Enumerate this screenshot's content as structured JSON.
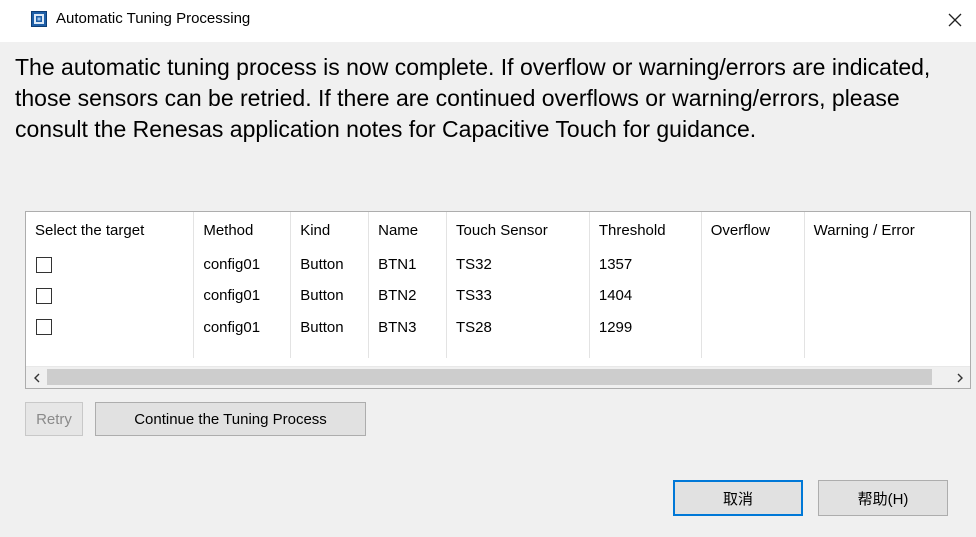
{
  "window": {
    "title": "Automatic Tuning Processing",
    "app_icon": "app-icon",
    "close_icon": "close-icon"
  },
  "message": "The automatic tuning process is now complete. If overflow or warning/errors are indicated, those sensors can be retried. If there are continued overflows or warning/errors, please consult the Renesas application notes for Capacitive Touch for guidance.",
  "table": {
    "columns": [
      "Select the target",
      "Method",
      "Kind",
      "Name",
      "Touch Sensor",
      "Threshold",
      "Overflow",
      "Warning / Error"
    ],
    "rows": [
      {
        "checked": false,
        "method": "config01",
        "kind": "Button",
        "name": "BTN1",
        "touch_sensor": "TS32",
        "threshold": "1357",
        "overflow": "",
        "warning_error": ""
      },
      {
        "checked": false,
        "method": "config01",
        "kind": "Button",
        "name": "BTN2",
        "touch_sensor": "TS33",
        "threshold": "1404",
        "overflow": "",
        "warning_error": ""
      },
      {
        "checked": false,
        "method": "config01",
        "kind": "Button",
        "name": "BTN3",
        "touch_sensor": "TS28",
        "threshold": "1299",
        "overflow": "",
        "warning_error": ""
      }
    ]
  },
  "scrollbar": {
    "left_arrow_icon": "chevron-left-icon",
    "right_arrow_icon": "chevron-right-icon"
  },
  "buttons": {
    "retry": "Retry",
    "continue": "Continue the Tuning Process",
    "cancel": "取消",
    "help": "帮助(H)"
  },
  "colors": {
    "window_bg": "#f0f0f0",
    "accent": "#0078d7",
    "button_bg": "#e1e1e1"
  }
}
